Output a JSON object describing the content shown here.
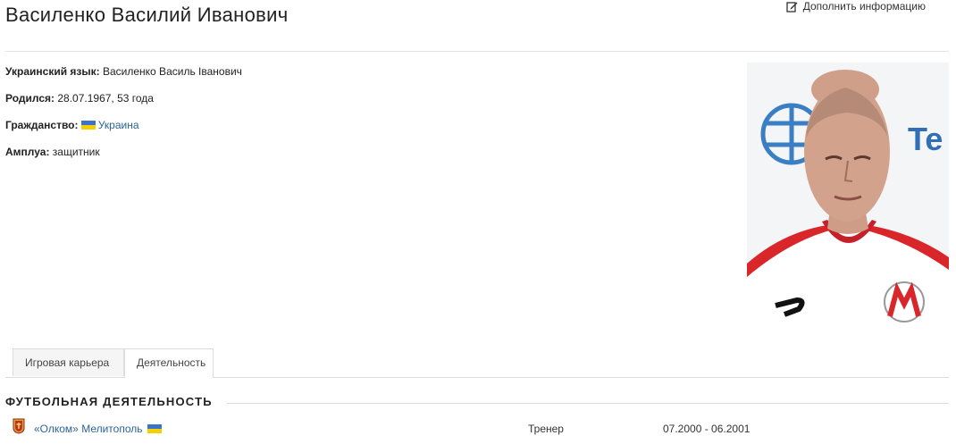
{
  "header": {
    "title": "Василенко Василий Иванович",
    "edit_label": "Дополнить информацию"
  },
  "facts": {
    "ukrainian": {
      "label": "Украинский язык:",
      "value": "Василенко Василь Іванович"
    },
    "born": {
      "label": "Родился:",
      "value": "28.07.1967, 53 года"
    },
    "citizenship": {
      "label": "Гражданство:",
      "value": "Украина",
      "flag": "ukraine-flag"
    },
    "position": {
      "label": "Амплуа:",
      "value": "защитник"
    }
  },
  "tabs": [
    {
      "label": "Игровая карьера",
      "active": false
    },
    {
      "label": "Деятельность",
      "active": true
    }
  ],
  "section": {
    "title": "ФУТБОЛЬНАЯ ДЕЯТЕЛЬНОСТЬ",
    "rows": [
      {
        "club": "«Олком» Мелитополь",
        "flag": "ukraine-flag",
        "role": "Тренер",
        "period": "07.2000 - 06.2001"
      }
    ]
  },
  "photo": {
    "background_text": "Te",
    "jersey_brand": "joma-logo",
    "badge": "olkom-badge"
  },
  "colors": {
    "link": "#2a6496",
    "flag_blue": "#3b73c9",
    "flag_yellow": "#f5d000",
    "jersey_red": "#d9262a"
  }
}
